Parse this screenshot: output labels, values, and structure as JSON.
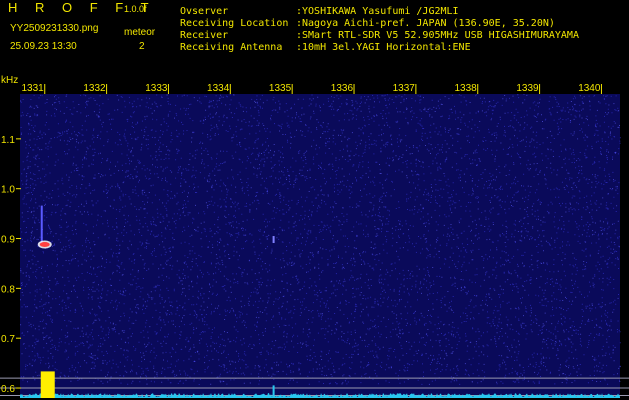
{
  "app": {
    "title": "H R O F F T",
    "version": "1.0.0f",
    "filename": "YY2509231330.png",
    "datetime": "25.09.23 13:30",
    "meteor_label": "meteor",
    "meteor_count": "2"
  },
  "station": {
    "labels": {
      "observer": "Ovserver",
      "location": "Receiving Location",
      "receiver": "Receiver",
      "antenna": "Receiving Antenna"
    },
    "values": {
      "observer": ":YOSHIKAWA Yasufumi /JG2MLI",
      "location": ":Nagoya Aichi-pref. JAPAN (136.90E, 35.20N)",
      "receiver": ":SMart RTL-SDR V5 52.905MHz USB HIGASHIMURAYAMA",
      "antenna": ":10mH 3el.YAGI Horizontal:ENE"
    }
  },
  "chart_data": {
    "type": "heatmap",
    "ylabel": "kHz",
    "x_ticks": [
      "1331",
      "1332",
      "1333",
      "1334",
      "1335",
      "1336",
      "1337",
      "1338",
      "1339",
      "1340"
    ],
    "y_ticks": [
      "1.1",
      "1.0",
      "0.9",
      "0.8",
      "0.7",
      "0.6"
    ],
    "x_range": [
      1330.6,
      1340.3
    ],
    "y_range": [
      0.58,
      1.19
    ],
    "grid": false,
    "colors": {
      "background": "#0a0a5a",
      "noise_high": "#3e3ef0",
      "meteor_core": "#ff4040",
      "meteor_halo": "#ffffff",
      "level_trace": "#28c8f0",
      "level_peak": "#ffee00",
      "text": "#f2e600"
    },
    "meteors": [
      {
        "x": 1331.0,
        "freq_top": 0.95,
        "freq_bottom": 0.89,
        "note": ""
      },
      {
        "x": 1334.7,
        "freq_top": 0.905,
        "freq_bottom": 0.895,
        "note": ""
      }
    ],
    "reference_lines_khz": [
      0.62,
      0.6,
      0.585
    ],
    "level_trace": {
      "peaks": [
        {
          "x": 1331.0,
          "level": 0.95
        },
        {
          "x": 1334.7,
          "level": 0.45
        }
      ]
    }
  }
}
